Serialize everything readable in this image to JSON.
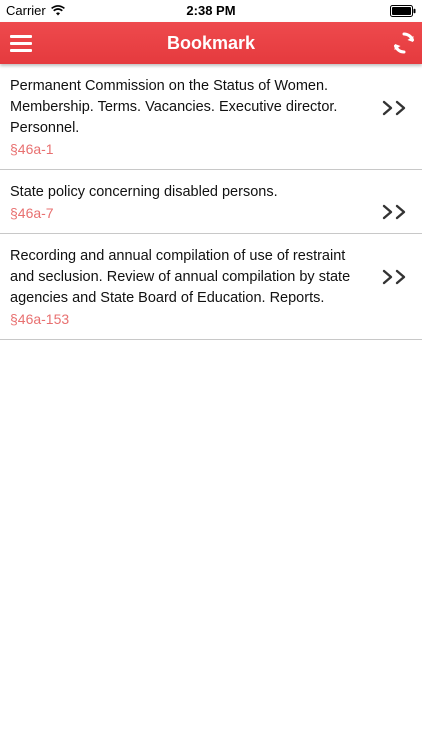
{
  "status_bar": {
    "carrier": "Carrier",
    "time": "2:38 PM"
  },
  "nav": {
    "title": "Bookmark",
    "left_icon": "menu-icon",
    "right_icon": "sync-icon",
    "bar_color": "#e8404a"
  },
  "bookmarks": [
    {
      "title": "Permanent Commission on the Status of Women. Membership. Terms. Vacancies. Executive director. Personnel.",
      "section": "§46a-1"
    },
    {
      "title": "State policy concerning disabled persons.",
      "section": "§46a-7"
    },
    {
      "title": "Recording and annual compilation of use of restraint and seclusion. Review of annual compilation by state agencies and State Board of Education. Reports.",
      "section": "§46a-153"
    }
  ],
  "colors": {
    "accent": "#e8404a",
    "section_code": "#e87070"
  }
}
